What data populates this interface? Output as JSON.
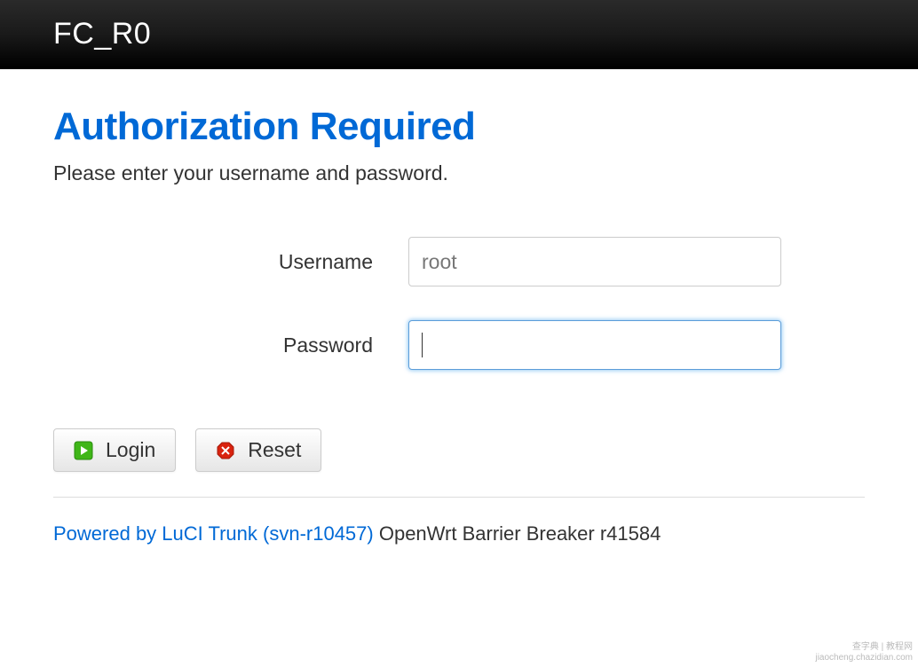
{
  "header": {
    "brand": "FC_R0"
  },
  "page": {
    "title": "Authorization Required",
    "subtitle": "Please enter your username and password."
  },
  "form": {
    "username": {
      "label": "Username",
      "value": "root"
    },
    "password": {
      "label": "Password",
      "value": ""
    }
  },
  "buttons": {
    "login": "Login",
    "reset": "Reset"
  },
  "footer": {
    "link_text": "Powered by LuCI Trunk (svn-r10457)",
    "after_text": " OpenWrt Barrier Breaker r41584"
  },
  "watermark": {
    "line1": "查字典 | 教程网",
    "line2": "jiaocheng.chazidian.com"
  }
}
